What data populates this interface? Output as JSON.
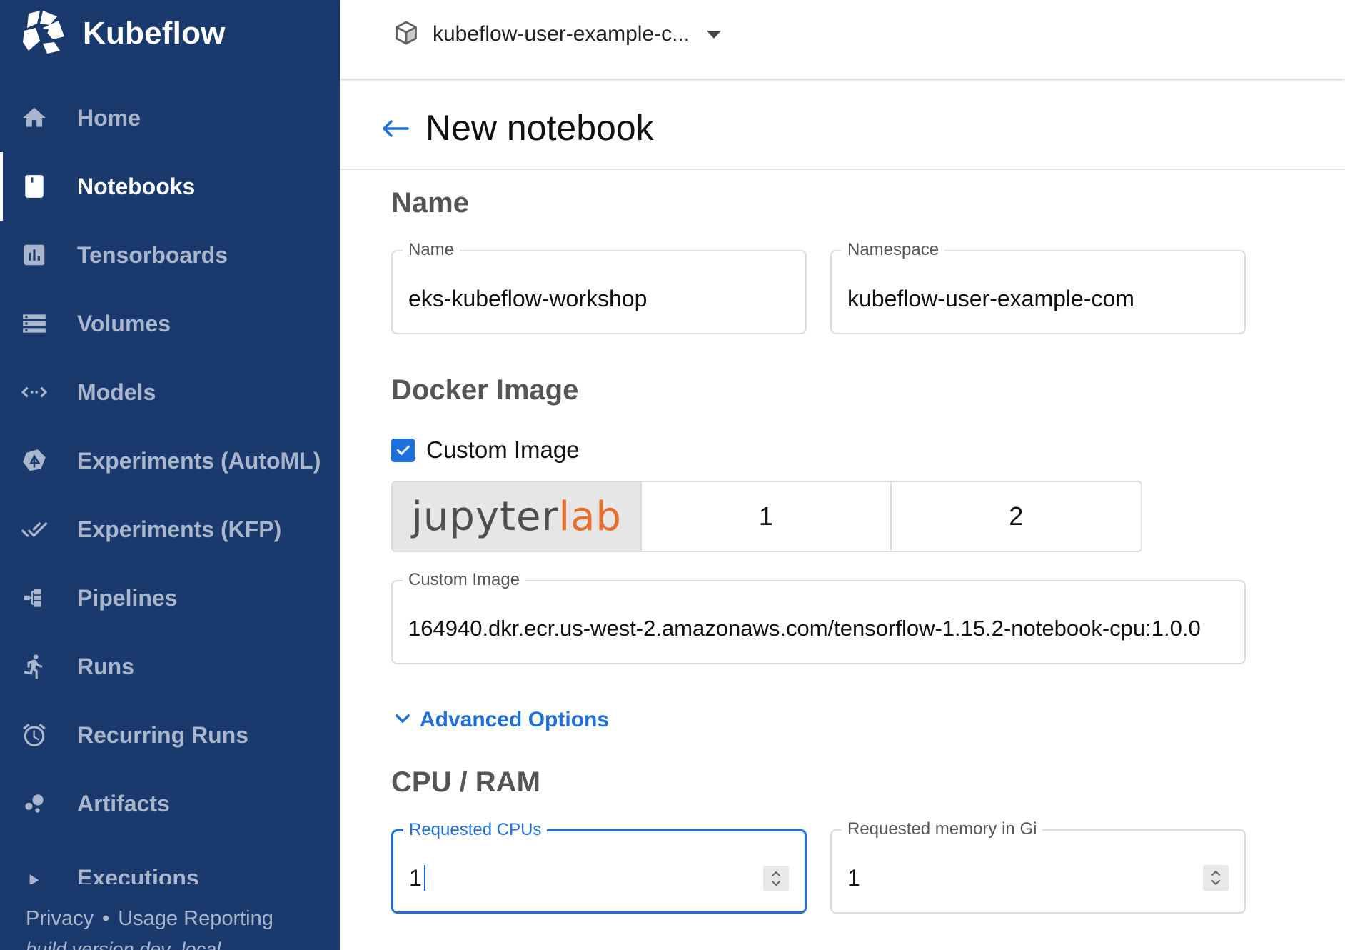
{
  "brand": {
    "name": "Kubeflow",
    "icon": "kubeflow-logo"
  },
  "sidebar": {
    "items": [
      {
        "label": "Home",
        "icon": "home-icon"
      },
      {
        "label": "Notebooks",
        "icon": "notebook-icon",
        "active": true
      },
      {
        "label": "Tensorboards",
        "icon": "bar-chart-icon"
      },
      {
        "label": "Volumes",
        "icon": "storage-icon"
      },
      {
        "label": "Models",
        "icon": "arrows-horizontal-icon"
      },
      {
        "label": "Experiments (AutoML)",
        "icon": "katib-icon"
      },
      {
        "label": "Experiments (KFP)",
        "icon": "done-all-icon"
      },
      {
        "label": "Pipelines",
        "icon": "pipelines-icon"
      },
      {
        "label": "Runs",
        "icon": "run-icon"
      },
      {
        "label": "Recurring Runs",
        "icon": "alarm-icon"
      },
      {
        "label": "Artifacts",
        "icon": "bubble-chart-icon"
      },
      {
        "label": "Executions",
        "icon": "play-arrow-icon"
      }
    ],
    "footer": {
      "privacy": "Privacy",
      "separator": "•",
      "usage": "Usage Reporting",
      "build": "build version dev_local"
    }
  },
  "topbar": {
    "namespace": "kubeflow-user-example-c...",
    "namespace_icon": "cube-icon"
  },
  "page": {
    "title": "New notebook",
    "back_icon": "arrow-back-icon"
  },
  "form": {
    "name_section": {
      "title": "Name",
      "name_label": "Name",
      "name_value": "eks-kubeflow-workshop",
      "namespace_label": "Namespace",
      "namespace_value": "kubeflow-user-example-com"
    },
    "docker_section": {
      "title": "Docker Image",
      "custom_image_checkbox_label": "Custom Image",
      "custom_image_checked": true,
      "image_options": {
        "logo_text_a": "jupyter",
        "logo_text_b": "lab",
        "option_1": "1",
        "option_2": "2"
      },
      "custom_image_label": "Custom Image",
      "custom_image_value": "164940.dkr.ecr.us-west-2.amazonaws.com/tensorflow-1.15.2-notebook-cpu:1.0.0"
    },
    "advanced_options_label": "Advanced Options",
    "cpu_section": {
      "title": "CPU / RAM",
      "cpu_label": "Requested CPUs",
      "cpu_value": "1",
      "memory_label": "Requested memory in Gi",
      "memory_value": "1"
    }
  },
  "colors": {
    "sidebar_bg": "#1a3a6d",
    "accent": "#1e6fd9",
    "jupyterlab_orange": "#e46e2e"
  }
}
